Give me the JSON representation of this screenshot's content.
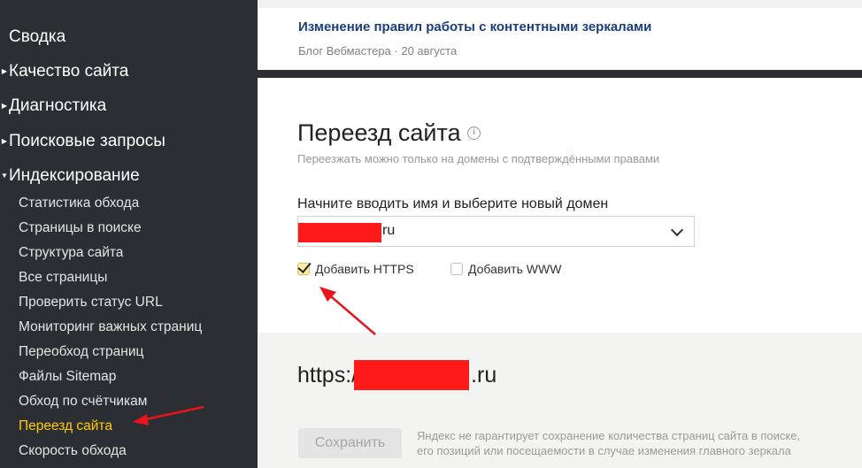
{
  "sidebar": {
    "top_item": "Сводка",
    "sections": [
      {
        "label": "Качество сайта"
      },
      {
        "label": "Диагностика"
      },
      {
        "label": "Поисковые запросы"
      },
      {
        "label": "Индексирование"
      }
    ],
    "sub_items": [
      {
        "label": "Статистика обхода"
      },
      {
        "label": "Страницы в поиске"
      },
      {
        "label": "Структура сайта"
      },
      {
        "label": "Все страницы"
      },
      {
        "label": "Проверить статус URL"
      },
      {
        "label": "Мониторинг важных страниц"
      },
      {
        "label": "Переобход страниц"
      },
      {
        "label": "Файлы Sitemap"
      },
      {
        "label": "Обход по счётчикам"
      },
      {
        "label": "Переезд сайта"
      },
      {
        "label": "Скорость обхода"
      }
    ],
    "active_item": "Переезд сайта",
    "active_color": "#ffcc00"
  },
  "news": {
    "title": "Изменение правил работы с контентными зеркалами",
    "meta": "Блог Вебмастера · 20 августа"
  },
  "main": {
    "title": "Переезд сайта",
    "info_icon": "info-icon",
    "subtitle": "Переезжать можно только на домены с подтверждёнными правами",
    "field_label": "Начните вводить имя и выберите новый домен",
    "domain_suffix": "ru",
    "https_label": "Добавить HTTPS",
    "https_checked": true,
    "www_label": "Добавить WWW",
    "www_checked": false
  },
  "preview": {
    "prefix": "https:/",
    "suffix": ".ru"
  },
  "save_label": "Сохранить",
  "disclaimer": {
    "line1": "Яндекс не гарантирует сохранение количества страниц сайта в поиске,",
    "line2": "его позиций или посещаемости в случае изменения главного зеркала"
  },
  "annotation_color": "#e8141c"
}
